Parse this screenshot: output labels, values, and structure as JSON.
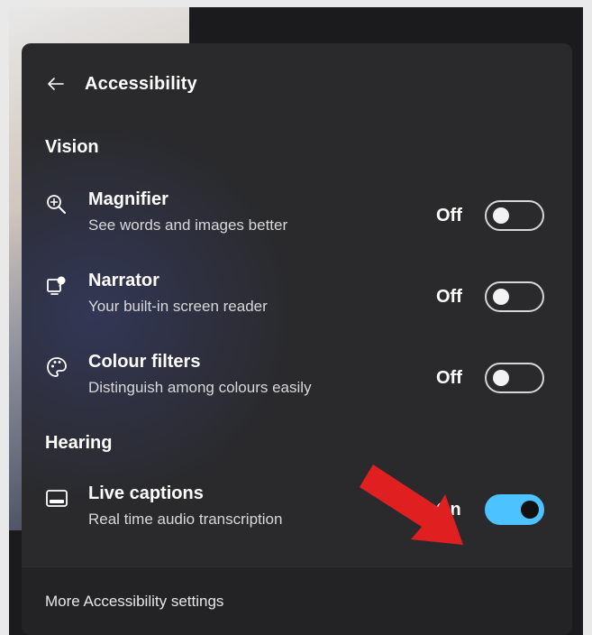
{
  "header": {
    "back_icon": "arrow-left-icon",
    "title": "Accessibility"
  },
  "sections": {
    "vision": "Vision",
    "hearing": "Hearing"
  },
  "rows": [
    {
      "title": "Magnifier",
      "description": "See words and images better",
      "state": "Off",
      "on": false,
      "icon": "magnifier-icon"
    },
    {
      "title": "Narrator",
      "description": "Your built-in screen reader",
      "state": "Off",
      "on": false,
      "icon": "narrator-icon"
    },
    {
      "title": "Colour filters",
      "description": "Distinguish among colours easily",
      "state": "Off",
      "on": false,
      "icon": "colour-filters-icon"
    },
    {
      "title": "Live captions",
      "description": "Real time audio transcription",
      "state": "On",
      "on": true,
      "icon": "live-captions-icon"
    }
  ],
  "footer": {
    "link": "More Accessibility settings"
  },
  "colors": {
    "accent": "#4cc2ff",
    "annotation_arrow": "#e02020"
  }
}
